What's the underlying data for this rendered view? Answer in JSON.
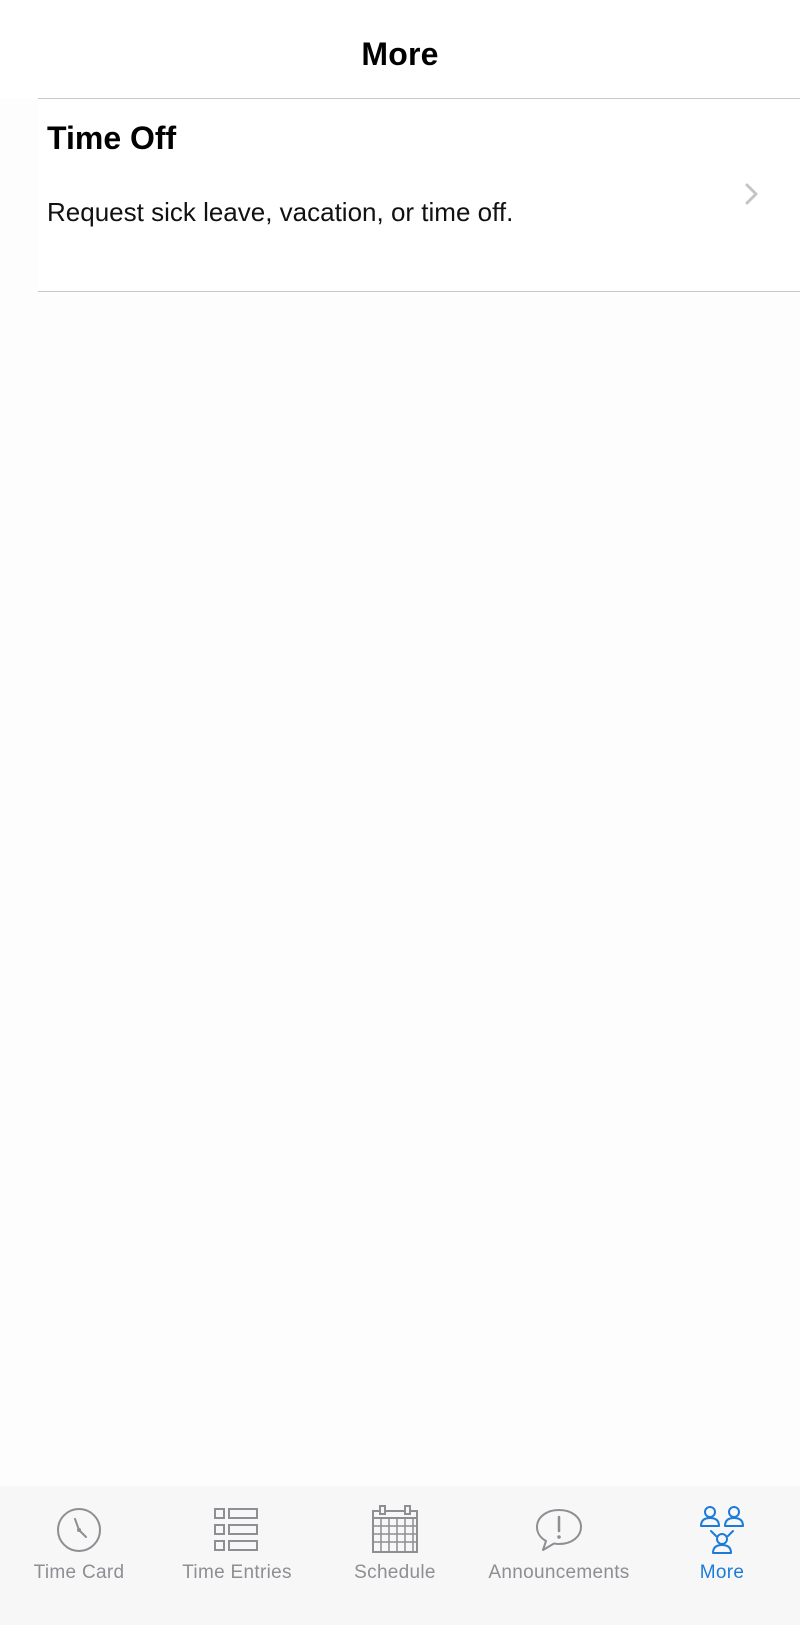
{
  "header": {
    "title": "More"
  },
  "list": {
    "items": [
      {
        "title": "Time Off",
        "subtitle": "Request sick leave, vacation, or time off."
      }
    ]
  },
  "tabbar": {
    "active_color": "#1d7bd8",
    "inactive_color": "#8e8e93",
    "items": [
      {
        "label": "Time Card",
        "icon": "clock-icon",
        "active": false
      },
      {
        "label": "Time Entries",
        "icon": "list-icon",
        "active": false
      },
      {
        "label": "Schedule",
        "icon": "calendar-icon",
        "active": false
      },
      {
        "label": "Announcements",
        "icon": "speech-bubble-icon",
        "active": false
      },
      {
        "label": "More",
        "icon": "people-icon",
        "active": true
      }
    ]
  }
}
